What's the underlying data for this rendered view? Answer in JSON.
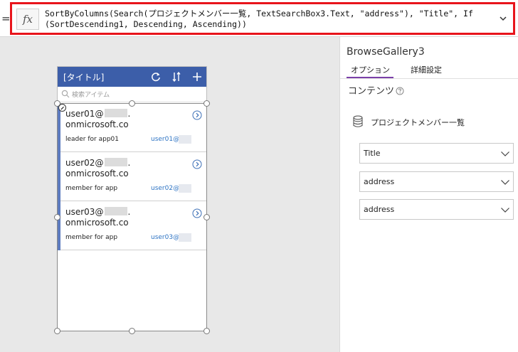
{
  "formula": {
    "equals": "=",
    "fx_label": "fx",
    "text": "SortByColumns(Search(プロジェクトメンバー一覧, TextSearchBox3.Text, \"address\"), \"Title\", If\n(SortDescending1, Descending, Ascending))",
    "border_color": "#e8141b"
  },
  "app_screen": {
    "header": {
      "title": "[タイトル]",
      "refresh_icon": "refresh-icon",
      "sort_icon": "sort-icon",
      "add_icon": "plus-icon",
      "color": "#3c5ea9"
    },
    "search": {
      "placeholder": "検索アイテム",
      "icon": "search-icon"
    },
    "gallery": {
      "items": [
        {
          "user": "user01@",
          "suffix": ".",
          "domain": "onmicrosoft.co",
          "role": "leader for app01",
          "mail": "user01@"
        },
        {
          "user": "user02@",
          "suffix": ".",
          "domain": "onmicrosoft.co",
          "role": "member for app",
          "mail": "user02@"
        },
        {
          "user": "user03@",
          "suffix": ".",
          "domain": "onmicrosoft.co",
          "role": "member for app",
          "mail": "user03@"
        }
      ]
    }
  },
  "properties": {
    "title": "BrowseGallery3",
    "tabs": [
      "オプション",
      "詳細設定"
    ],
    "active_tab": "オプション",
    "section": "コンテンツ",
    "data_source": "プロジェクトメンバー一覧",
    "dropdowns": [
      "Title",
      "address",
      "address"
    ],
    "accent": "#7a3fa8"
  }
}
